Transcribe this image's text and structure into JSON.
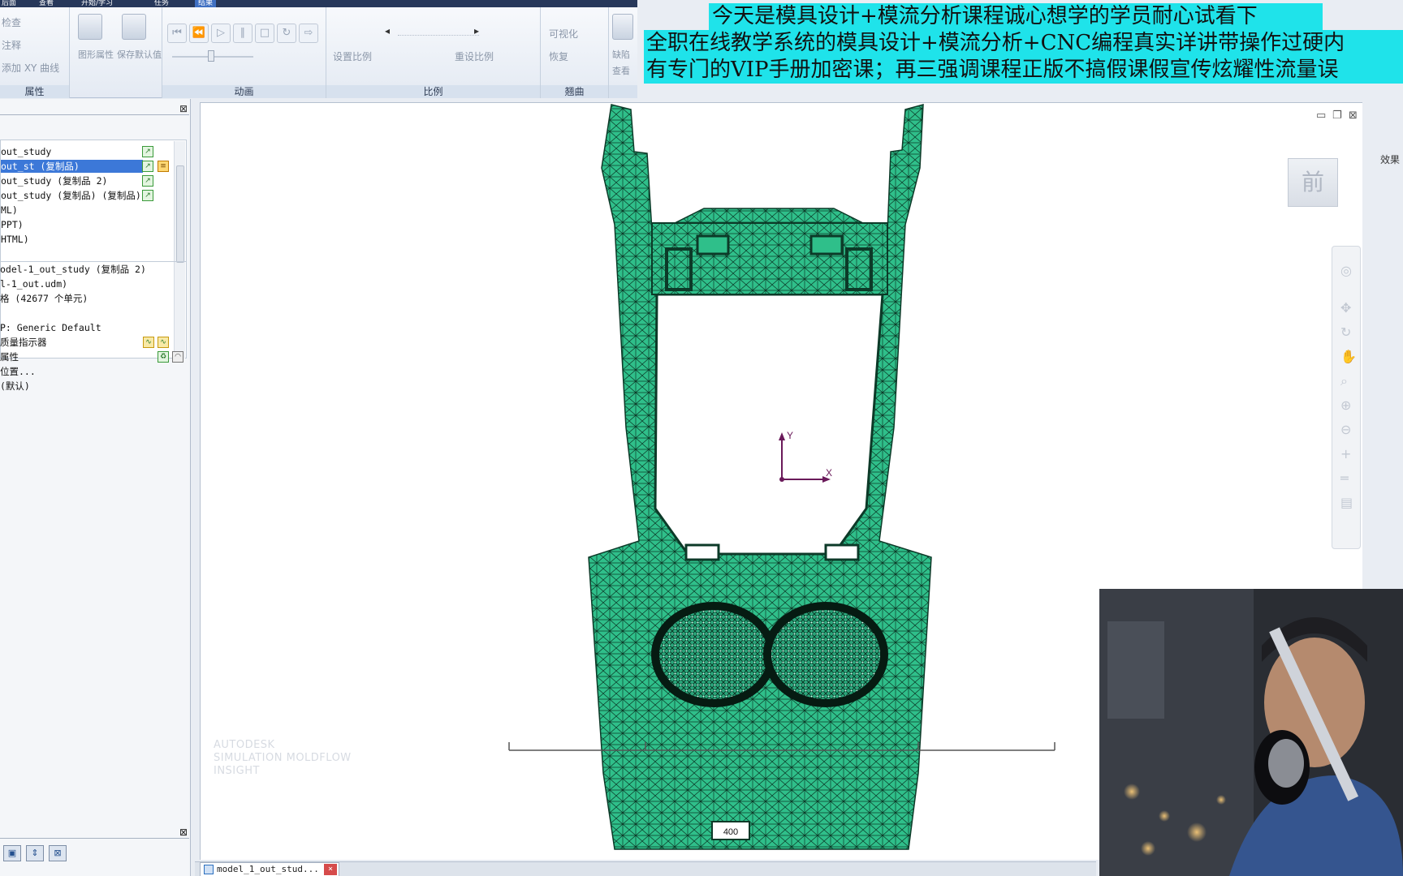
{
  "top_tabs": [
    "后面",
    "查看",
    "开始/学习",
    "任务",
    "结果"
  ],
  "ribbon": {
    "groups": [
      {
        "title": "属性",
        "items": [
          "检查",
          "注释",
          "添加 XY 曲线",
          "图形属性",
          "保存默认值"
        ]
      },
      {
        "title": "动画"
      },
      {
        "title": "比例",
        "items": [
          "设置比例",
          "重设比例"
        ]
      },
      {
        "title": "翘曲",
        "items": [
          "可视化",
          "恢复"
        ]
      },
      {
        "title": "",
        "items": [
          "缺陷",
          "查看"
        ]
      }
    ]
  },
  "banner": {
    "line1": "今天是模具设计+模流分析课程诚心想学的学员耐心试看下",
    "line2": "全职在线教学系统的模具设计+模流分析+CNC编程真实详讲带操作过硬内",
    "line3": "有专门的VIP手册加密课；再三强调课程正版不搞假课假宣传炫耀性流量误"
  },
  "tree": {
    "rows": [
      {
        "label": "out_study",
        "selected": false
      },
      {
        "label": "out_st (复制品)",
        "selected": true
      },
      {
        "label": "out_study (复制品 2)",
        "selected": false
      },
      {
        "label": "out_study (复制品) (复制品)",
        "selected": false
      },
      {
        "label": "ML)",
        "selected": false
      },
      {
        "label": "PPT)",
        "selected": false
      },
      {
        "label": "HTML)",
        "selected": false
      }
    ]
  },
  "properties": {
    "lines": [
      "odel-1_out_study (复制品 2)",
      "l-1_out.udm)",
      "格 (42677 个单元)",
      "",
      "P: Generic Default",
      "质量指示器",
      "属性",
      "位置...",
      "(默认)"
    ]
  },
  "viewport": {
    "axis_x": "X",
    "axis_y": "Y",
    "viewcube_label": "前",
    "watermark": [
      "AUTODESK",
      "SIMULATION MOLDFLOW",
      "INSIGHT"
    ],
    "scale_label": "400"
  },
  "sidebar_right_text": "效果",
  "doc_tab": {
    "label": "model_1_out_stud...",
    "close": "×"
  },
  "colors": {
    "mesh_fill": "#2fbf8a",
    "mesh_line": "#0c3a28",
    "selection": "#3c78d8",
    "banner_bg": "#1fe3ea"
  }
}
